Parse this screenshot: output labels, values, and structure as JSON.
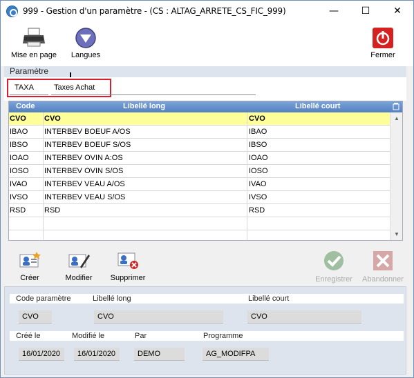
{
  "window": {
    "title": "999 - Gestion d'un paramètre - (CS : ALTAG_ARRETE_CS_FIC_999)",
    "minimize": "—",
    "maximize": "☐",
    "close": "✕"
  },
  "toolbar": {
    "print_label": "Mise en page",
    "languages_label": "Langues",
    "close_label": "Fermer"
  },
  "panel": {
    "title": "Paramètre",
    "filter_code": "TAXA",
    "filter_label": "Taxes Achat"
  },
  "grid": {
    "columns": [
      "Code",
      "Libellé long",
      "Libellé court"
    ],
    "rows": [
      {
        "code": "CVO",
        "long": "CVO",
        "short": "CVO",
        "selected": true
      },
      {
        "code": "IBAO",
        "long": "INTERBEV BOEUF A/OS",
        "short": "IBAO"
      },
      {
        "code": "IBSO",
        "long": "INTERBEV BOEUF S/OS",
        "short": "IBSO"
      },
      {
        "code": "IOAO",
        "long": "INTERBEV OVIN A:OS",
        "short": "IOAO"
      },
      {
        "code": "IOSO",
        "long": "INTERBEV OVIN S/OS",
        "short": "IOSO"
      },
      {
        "code": "IVAO",
        "long": "INTERBEV VEAU A/OS",
        "short": "IVAO"
      },
      {
        "code": "IVSO",
        "long": "INTERBEV VEAU S/OS",
        "short": "IVSO"
      },
      {
        "code": "RSD",
        "long": "RSD",
        "short": "RSD"
      },
      {
        "code": "",
        "long": "",
        "short": ""
      },
      {
        "code": "",
        "long": "",
        "short": ""
      }
    ]
  },
  "actions": {
    "create": "Créer",
    "modify": "Modifier",
    "delete": "Supprimer",
    "save": "Enregistrer",
    "abandon": "Abandonner"
  },
  "detail": {
    "code_label": "Code paramètre",
    "long_label": "Libellé long",
    "short_label": "Libellé court",
    "code_value": "CVO",
    "long_value": "CVO",
    "short_value": "CVO",
    "created_label": "Créé le",
    "modified_label": "Modifié le",
    "by_label": "Par",
    "program_label": "Programme",
    "created_value": "16/01/2020",
    "modified_value": "16/01/2020",
    "by_value": "DEMO",
    "program_value": "AG_MODIFPA"
  }
}
